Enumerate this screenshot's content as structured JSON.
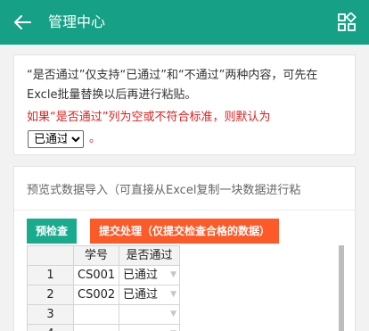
{
  "header": {
    "title": "管理中心",
    "background": "#16a085"
  },
  "notice": {
    "text": "“是否通过”仅支持“已通过”和“不通过”两种内容，可先在Excle批量替换以后再进行粘贴。",
    "warning": "如果“是否通过”列为空或不符合标准，则默认为",
    "default_option": "已通过",
    "period": "。"
  },
  "import": {
    "title": "预览式数据导入（可直接从Excel复制一块数据进行粘",
    "check_label": "预检查",
    "submit_label": "提交处理（仅提交检查合格的数据）",
    "check_color": "#1aaa8e",
    "submit_color": "#fd5a29"
  },
  "sheet": {
    "columns": [
      "学号",
      "是否通过"
    ],
    "rows": [
      {
        "num": "1",
        "id": "CS001",
        "pass": "已通过"
      },
      {
        "num": "2",
        "id": "CS002",
        "pass": "已通过"
      },
      {
        "num": "3",
        "id": "",
        "pass": ""
      },
      {
        "num": "4",
        "id": "",
        "pass": ""
      }
    ]
  }
}
